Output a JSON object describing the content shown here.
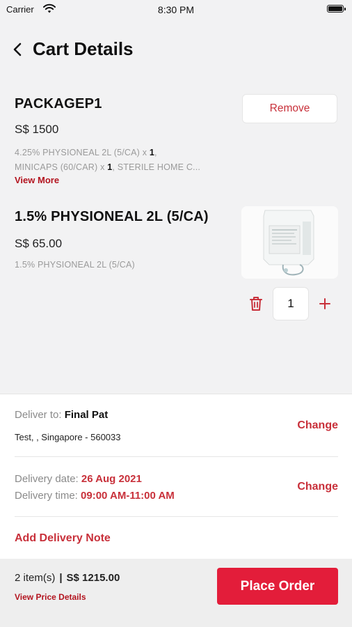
{
  "status_bar": {
    "carrier": "Carrier",
    "time": "8:30 PM"
  },
  "header": {
    "title": "Cart Details"
  },
  "cart": {
    "items": [
      {
        "name": "PACKAGEP1",
        "price": "S$ 1500",
        "description": {
          "line1_text": "4.25% PHYSIONEAL 2L (5/CA) x ",
          "line1_qty": "1",
          "line2_text": "MINICAPS (60/CAR) x ",
          "line2_qty": "1",
          "line2_rest": ", STERILE HOME C..."
        },
        "view_more_label": "View More",
        "remove_label": "Remove"
      },
      {
        "name": "1.5% PHYSIONEAL 2L (5/CA)",
        "price": "S$ 65.00",
        "description": "1.5% PHYSIONEAL 2L (5/CA)",
        "quantity": "1"
      }
    ]
  },
  "delivery": {
    "deliver_to_label": "Deliver to: ",
    "deliver_to_name": "Final Pat",
    "address": "Test, , Singapore - 560033",
    "change_label": "Change",
    "date_label": "Delivery date: ",
    "date_value": "26 Aug 2021",
    "time_label": "Delivery time: ",
    "time_value": "09:00 AM-11:00 AM",
    "add_note_label": "Add Delivery Note"
  },
  "footer": {
    "item_count": "2 item(s)",
    "separator": "|",
    "total": "S$ 1215.00",
    "view_price_details": "View Price Details",
    "place_order_label": "Place Order"
  },
  "colors": {
    "accent": "#c8303a",
    "button": "#e31d3a",
    "background": "#f2f2f3"
  },
  "icons": [
    "wifi-icon",
    "battery-icon",
    "back-chevron-icon",
    "trash-icon",
    "plus-icon"
  ]
}
